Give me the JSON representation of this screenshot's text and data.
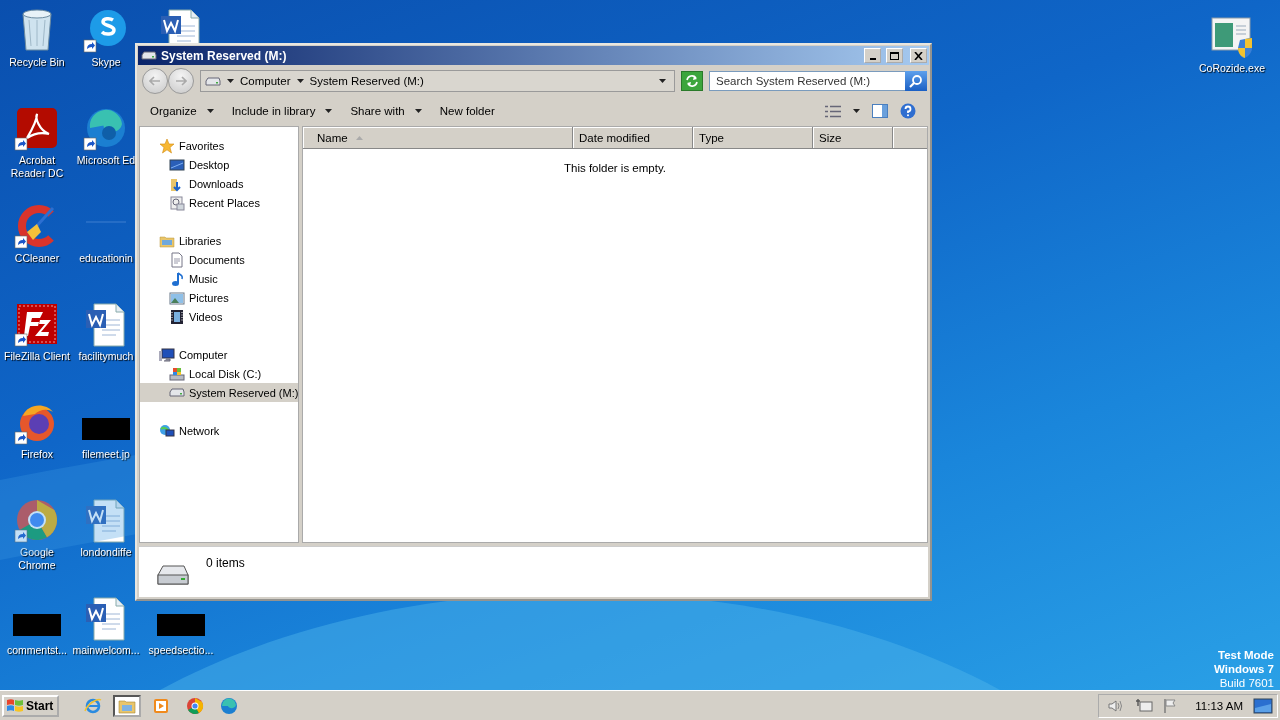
{
  "desktop": {
    "columns": [
      [
        {
          "label": "Recycle Bin",
          "kind": "recycle-bin",
          "shortcut": false
        },
        {
          "label": "Acrobat Reader DC",
          "kind": "acrobat",
          "shortcut": true
        },
        {
          "label": "CCleaner",
          "kind": "ccleaner",
          "shortcut": true
        },
        {
          "label": "FileZilla Client",
          "kind": "filezilla",
          "shortcut": true
        },
        {
          "label": "Firefox",
          "kind": "firefox",
          "shortcut": true
        },
        {
          "label": "Google Chrome",
          "kind": "chrome",
          "shortcut": true
        },
        {
          "label": "commentst...",
          "kind": "thumbnail",
          "shortcut": false
        }
      ],
      [
        {
          "label": "Skype",
          "kind": "skype",
          "shortcut": true
        },
        {
          "label": "Microsoft Ed",
          "kind": "edge",
          "shortcut": true
        },
        {
          "label": "educationin",
          "kind": "blank",
          "shortcut": false
        },
        {
          "label": "facilitymuch",
          "kind": "word-doc",
          "shortcut": false
        },
        {
          "label": "filemeet.jp",
          "kind": "thumbnail",
          "shortcut": false
        },
        {
          "label": "londondiffe",
          "kind": "word-doc",
          "shortcut": false
        },
        {
          "label": "mainwelcom...",
          "kind": "word-doc",
          "shortcut": false
        }
      ],
      [
        {
          "kind": "word-doc",
          "shortcut": false
        },
        null,
        null,
        null,
        null,
        null,
        {
          "label": "speedsectio...",
          "kind": "thumbnail",
          "shortcut": false
        }
      ]
    ],
    "corner_icon": {
      "label": "CoRozide.exe",
      "kind": "exe",
      "shortcut": false
    },
    "os_notice": [
      "Test Mode",
      "Windows 7",
      "Build 7601"
    ]
  },
  "window": {
    "title": "System Reserved (M:)",
    "address": [
      "Computer",
      "System Reserved (M:)"
    ],
    "search": {
      "placeholder": "Search System Reserved (M:)"
    },
    "toolbar": [
      {
        "label": "Organize",
        "dropdown": true
      },
      {
        "label": "Include in library",
        "dropdown": true
      },
      {
        "label": "Share with",
        "dropdown": true
      },
      {
        "label": "New folder",
        "dropdown": false
      }
    ],
    "nav": [
      {
        "label": "Favorites",
        "kind": "star",
        "selected": false,
        "children": [
          {
            "label": "Desktop",
            "kind": "desktop",
            "selected": false
          },
          {
            "label": "Downloads",
            "kind": "downloads",
            "selected": false
          },
          {
            "label": "Recent Places",
            "kind": "recent",
            "selected": false
          }
        ]
      },
      {
        "label": "Libraries",
        "kind": "library",
        "selected": false,
        "children": [
          {
            "label": "Documents",
            "kind": "document",
            "selected": false
          },
          {
            "label": "Music",
            "kind": "music",
            "selected": false
          },
          {
            "label": "Pictures",
            "kind": "pictures",
            "selected": false
          },
          {
            "label": "Videos",
            "kind": "videos",
            "selected": false
          }
        ]
      },
      {
        "label": "Computer",
        "kind": "computer",
        "selected": false,
        "children": [
          {
            "label": "Local Disk (C:)",
            "kind": "disk",
            "selected": false
          },
          {
            "label": "System Reserved (M:)",
            "kind": "drive",
            "selected": true
          }
        ]
      },
      {
        "label": "Network",
        "kind": "network",
        "selected": false
      }
    ],
    "columns": [
      {
        "label": "Name",
        "sorted": true
      },
      {
        "label": "Date modified",
        "sorted": false
      },
      {
        "label": "Type",
        "sorted": false
      },
      {
        "label": "Size",
        "sorted": false
      }
    ],
    "empty_message": "This folder is empty.",
    "details": {
      "count": "0 items"
    }
  },
  "taskbar": {
    "start": "Start",
    "pinned": [
      {
        "kind": "ie",
        "active": false
      },
      {
        "kind": "explorer",
        "active": true
      },
      {
        "kind": "media",
        "active": false
      },
      {
        "kind": "chrome",
        "active": false
      },
      {
        "kind": "edge",
        "active": false
      }
    ],
    "clock": "11:13 AM"
  }
}
